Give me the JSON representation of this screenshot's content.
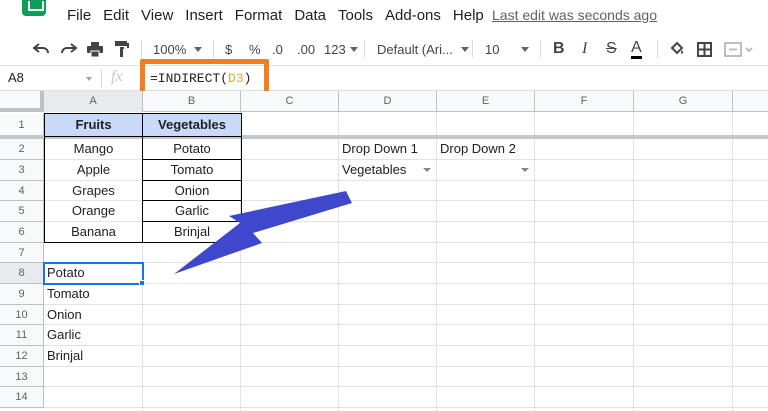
{
  "menu": {
    "items": [
      "File",
      "Edit",
      "View",
      "Insert",
      "Format",
      "Data",
      "Tools",
      "Add-ons",
      "Help"
    ],
    "last_edit": "Last edit was seconds ago"
  },
  "toolbar": {
    "zoom": "100%",
    "currency": "$",
    "percent": "%",
    "dec_decrease": ".0",
    "dec_increase": ".00",
    "more_formats": "123",
    "font": "Default (Ari...",
    "font_size": "10",
    "bold": "B",
    "italic": "I",
    "strike": "S",
    "text_color": "A"
  },
  "formula_bar": {
    "name_box": "A8",
    "fx": "fx",
    "formula_prefix": "=INDIRECT(",
    "formula_ref": "D3",
    "formula_suffix": ")"
  },
  "columns": [
    "A",
    "B",
    "C",
    "D",
    "E",
    "F",
    "G"
  ],
  "rows": [
    "1",
    "2",
    "3",
    "4",
    "5",
    "6",
    "7",
    "8",
    "9",
    "10",
    "11",
    "12",
    "13",
    "14"
  ],
  "table": {
    "headers": [
      "Fruits",
      "Vegetables"
    ],
    "fruits": [
      "Mango",
      "Apple",
      "Grapes",
      "Orange",
      "Banana"
    ],
    "vegetables": [
      "Potato",
      "Tomato",
      "Onion",
      "Garlic",
      "Brinjal"
    ]
  },
  "dropdowns": {
    "label1": "Drop Down 1",
    "label2": "Drop Down 2",
    "value1": "Vegetables",
    "value2": ""
  },
  "result": [
    "Potato",
    "Tomato",
    "Onion",
    "Garlic",
    "Brinjal"
  ],
  "colors": {
    "header_fill": "#c9daf8",
    "highlight_box": "#f47d20",
    "arrow": "#3f48cc",
    "selection": "#1a73e8"
  }
}
